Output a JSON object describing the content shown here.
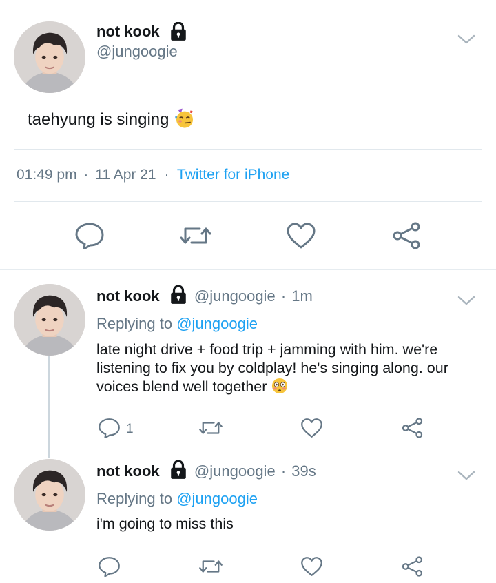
{
  "main_tweet": {
    "display_name": "not kook",
    "handle": "@jungoogie",
    "text": "taehyung is singing",
    "time": "01:49 pm",
    "date": "11 Apr 21",
    "client": "Twitter for iPhone",
    "sep1": "·",
    "sep2": "·"
  },
  "replies": [
    {
      "display_name": "not kook",
      "handle": "@jungoogie",
      "time": "1m",
      "replying_prefix": "Replying to",
      "replying_to": "@jungoogie",
      "text_lines": [
        "late night drive + food trip + jamming with him. we're",
        "listening to fix you by coldplay! he's singing along. our",
        "voices blend well together"
      ],
      "reply_count": "1"
    },
    {
      "display_name": "not kook",
      "handle": "@jungoogie",
      "time": "39s",
      "replying_prefix": "Replying to",
      "replying_to": "@jungoogie",
      "text_lines": [
        "i'm going to miss this"
      ],
      "reply_count": ""
    }
  ],
  "colors": {
    "accent": "#1da1f2",
    "secondary_text": "#657786",
    "icon": "#657786"
  },
  "icons": [
    "lock-icon",
    "chevron-down-icon",
    "reply-icon",
    "retweet-icon",
    "like-icon",
    "share-icon",
    "party-face-emoji",
    "flushed-face-emoji"
  ]
}
